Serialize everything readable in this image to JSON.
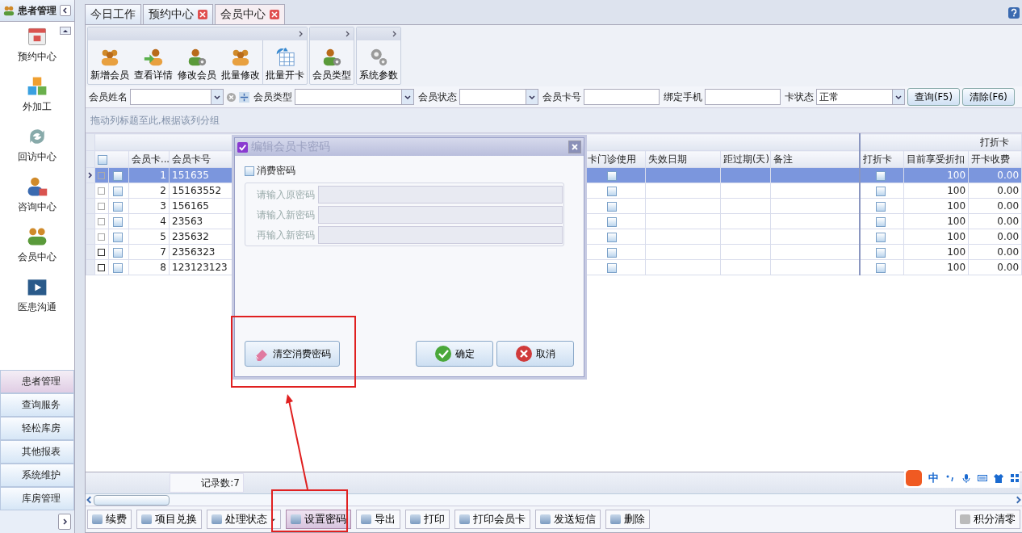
{
  "sidebar": {
    "title": "患者管理",
    "nav": [
      {
        "label": "预约中心",
        "kind": "calendar"
      },
      {
        "label": "外加工",
        "kind": "cubes"
      },
      {
        "label": "回访中心",
        "kind": "refresh"
      },
      {
        "label": "咨询中心",
        "kind": "person"
      },
      {
        "label": "会员中心",
        "kind": "people"
      },
      {
        "label": "医患沟通",
        "kind": "video"
      }
    ],
    "modules": [
      {
        "label": "患者管理",
        "selected": true
      },
      {
        "label": "查询服务",
        "selected": false
      },
      {
        "label": "轻松库房",
        "selected": false
      },
      {
        "label": "其他报表",
        "selected": false
      },
      {
        "label": "系统维护",
        "selected": false
      },
      {
        "label": "库房管理",
        "selected": false
      }
    ]
  },
  "tabs": [
    {
      "label": "今日工作",
      "selected": false,
      "closable": false
    },
    {
      "label": "预约中心",
      "selected": false,
      "closable": true
    },
    {
      "label": "会员中心",
      "selected": true,
      "closable": true
    }
  ],
  "ribbon": [
    [
      {
        "label": "新增会员",
        "kind": "people"
      },
      {
        "label": "查看详情",
        "kind": "arrow"
      },
      {
        "label": "修改会员",
        "kind": "gear"
      },
      {
        "label": "批量修改",
        "kind": "people"
      },
      {
        "label": "批量开卡",
        "kind": "table"
      }
    ],
    [
      {
        "label": "会员类型",
        "kind": "gear"
      }
    ],
    [
      {
        "label": "系统参数",
        "kind": "gears"
      }
    ]
  ],
  "filters": [
    {
      "label": "会员姓名",
      "kind": "name"
    },
    {
      "label": "会员类型",
      "kind": "combo"
    },
    {
      "label": "会员状态",
      "kind": "combo"
    },
    {
      "label": "会员卡号",
      "kind": "text"
    },
    {
      "label": "绑定手机",
      "kind": "text"
    },
    {
      "label": "卡状态",
      "kind": "combo",
      "value": "正常"
    }
  ],
  "filter_buttons": [
    "查询(F5)",
    "清除(F6)"
  ],
  "group_hint": "拖动列标题至此,根据该列分组",
  "band": "打折卡",
  "header_checkbox": {
    "checked": false
  },
  "columns": [
    "会员卡...",
    "会员卡号",
    "卡门诊使用",
    "失效日期",
    "距过期(天)",
    "备注",
    "打折卡",
    "目前享受折扣",
    "开卡收费"
  ],
  "rows": [
    {
      "kind": "light",
      "selected": true,
      "checked": false,
      "no": "1",
      "card": "151635",
      "clinic": false,
      "discount_card": false,
      "discount": "100",
      "fee": "0.00"
    },
    {
      "kind": "light",
      "selected": false,
      "checked": false,
      "no": "2",
      "card": "15163552",
      "clinic": false,
      "discount_card": false,
      "discount": "100",
      "fee": "0.00"
    },
    {
      "kind": "light",
      "selected": false,
      "checked": false,
      "no": "3",
      "card": "156165",
      "clinic": false,
      "discount_card": false,
      "discount": "100",
      "fee": "0.00"
    },
    {
      "kind": "light",
      "selected": false,
      "checked": false,
      "no": "4",
      "card": "23563",
      "clinic": false,
      "discount_card": false,
      "discount": "100",
      "fee": "0.00"
    },
    {
      "kind": "light",
      "selected": false,
      "checked": false,
      "no": "5",
      "card": "235632",
      "clinic": false,
      "discount_card": false,
      "discount": "100",
      "fee": "0.00"
    },
    {
      "kind": "dark",
      "selected": false,
      "checked": false,
      "no": "7",
      "card": "2356323",
      "clinic": false,
      "discount_card": false,
      "discount": "100",
      "fee": "0.00"
    },
    {
      "kind": "dark",
      "selected": false,
      "checked": false,
      "no": "8",
      "card": "123123123",
      "clinic": false,
      "discount_card": false,
      "discount": "100",
      "fee": "0.00"
    }
  ],
  "record_count": "记录数:7",
  "actions": [
    {
      "label": "续费",
      "dropdown": false,
      "pressed": false
    },
    {
      "label": "项目兑换",
      "dropdown": false,
      "pressed": false
    },
    {
      "label": "处理状态",
      "dropdown": true,
      "pressed": false
    },
    {
      "label": "设置密码",
      "dropdown": false,
      "pressed": true
    },
    {
      "label": "导出",
      "dropdown": false,
      "pressed": false
    },
    {
      "label": "打印",
      "dropdown": false,
      "pressed": false
    },
    {
      "label": "打印会员卡",
      "dropdown": false,
      "pressed": false
    },
    {
      "label": "发送短信",
      "dropdown": false,
      "pressed": false
    },
    {
      "label": "删除",
      "dropdown": false,
      "pressed": false
    }
  ],
  "right_action": "积分清零",
  "ime": {
    "label": "中"
  },
  "dialog": {
    "title": "编辑会员卡密码",
    "checkbox": {
      "label": "消费密码",
      "checked": false
    },
    "fields": [
      {
        "label": "请输入原密码",
        "disabled": true
      },
      {
        "label": "请输入新密码",
        "disabled": true
      },
      {
        "label": "再输入新密码",
        "disabled": true
      }
    ],
    "buttons": [
      {
        "label": "清空消费密码",
        "kind": "eraser"
      },
      {
        "label": "确定",
        "kind": "ok"
      },
      {
        "label": "取消",
        "kind": "cancel"
      }
    ]
  }
}
